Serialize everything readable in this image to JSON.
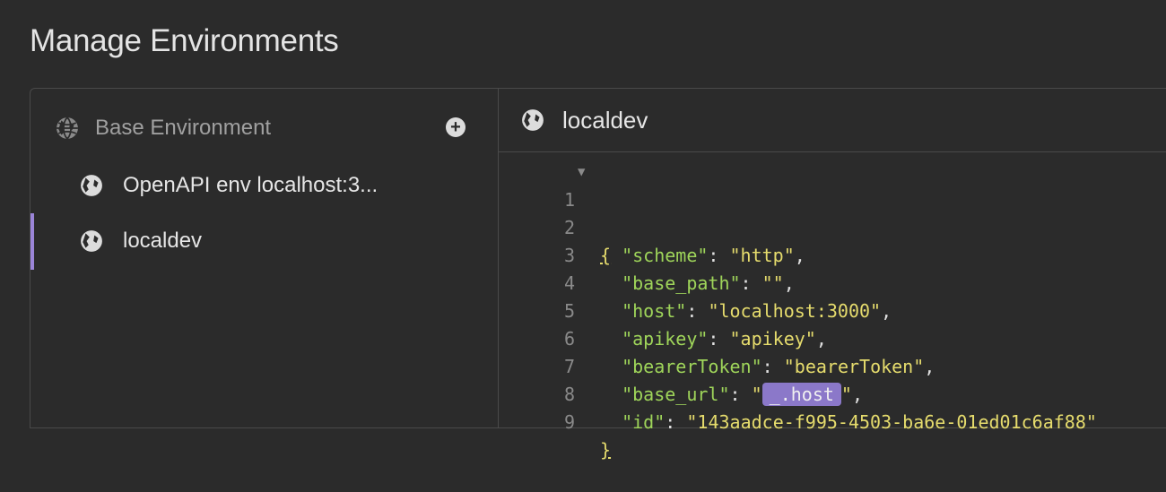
{
  "page": {
    "title": "Manage Environments"
  },
  "sidebar": {
    "base_environment": "Base Environment",
    "add_icon": "plus-circle-icon",
    "items": [
      {
        "label": "OpenAPI env localhost:3...",
        "icon": "globe-icon"
      },
      {
        "label": "localdev",
        "icon": "globe-icon",
        "active": true
      }
    ]
  },
  "editor": {
    "env_name": "localdev",
    "lines": [
      {
        "n": "1",
        "open": "{"
      },
      {
        "n": "2",
        "key": "\"scheme\"",
        "sep": ": ",
        "val": "\"http\"",
        "end": ","
      },
      {
        "n": "3",
        "key": "\"base_path\"",
        "sep": ": ",
        "val": "\"\"",
        "end": ","
      },
      {
        "n": "4",
        "key": "\"host\"",
        "sep": ": ",
        "val": "\"localhost:3000\"",
        "end": ","
      },
      {
        "n": "5",
        "key": "\"apikey\"",
        "sep": ": ",
        "val": "\"apikey\"",
        "end": ","
      },
      {
        "n": "6",
        "key": "\"bearerToken\"",
        "sep": ": ",
        "val": "\"bearerToken\"",
        "end": ","
      },
      {
        "n": "7",
        "key": "\"base_url\"",
        "sep": ": ",
        "q1": "\"",
        "tag": "_.host",
        "q2": "\"",
        "end": ","
      },
      {
        "n": "8",
        "key": "\"id\"",
        "sep": ": ",
        "val": "\"143aadce-f995-4503-ba6e-01ed01c6af88\"",
        "end": ""
      },
      {
        "n": "9",
        "close": "}"
      }
    ]
  },
  "colors": {
    "accent": "#9b85d8",
    "key": "#9fd55a",
    "string": "#e6dc6d",
    "tag_bg": "#8b78c9"
  }
}
